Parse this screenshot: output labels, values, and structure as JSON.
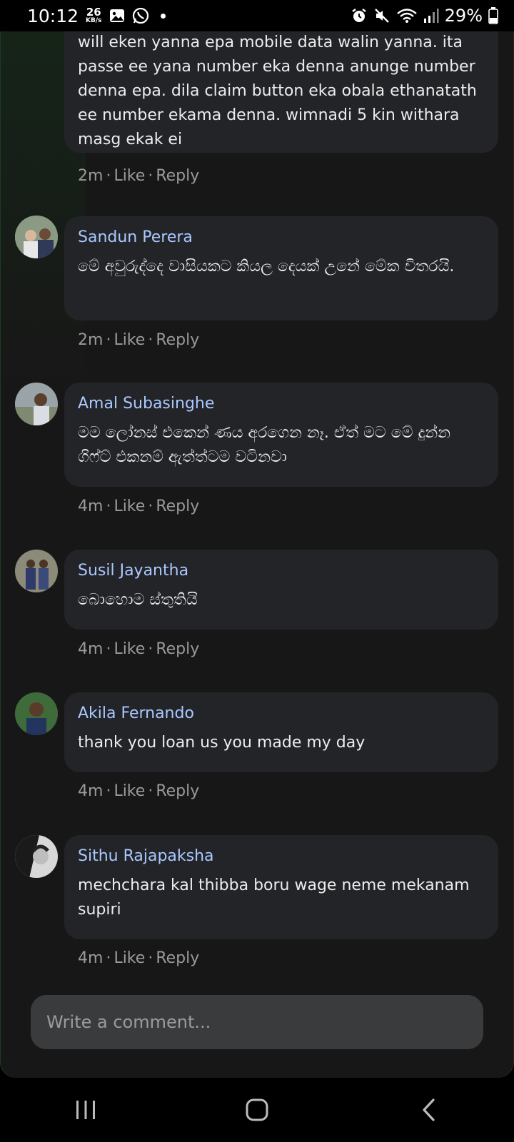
{
  "status_bar": {
    "time": "10:12",
    "net_speed_value": "26",
    "net_speed_unit": "KB/s",
    "battery_percent": "29%",
    "icons": [
      "gallery-icon",
      "whatsapp-icon",
      "dot",
      "alarm-icon",
      "mute-icon",
      "wifi-icon",
      "signal-icon",
      "battery-icon"
    ]
  },
  "partial_comment": {
    "text": "will eken yanna epa mobile data walin yanna. ita passe ee yana number eka denna anunge number denna epa. dila claim button eka obala ethanatath ee number ekama denna. wimnadi 5 kin withara masg ekak ei",
    "time": "2m",
    "like_label": "Like",
    "reply_label": "Reply"
  },
  "comments": [
    {
      "author": "Sandun Perera",
      "text": "මේ අවුරුද්දෙ වාසියකට කියල දෙයක් උනේ මේක විතරයි.",
      "time": "2m",
      "like_label": "Like",
      "reply_label": "Reply"
    },
    {
      "author": "Amal Subasinghe",
      "text": "මම ලෝනස් එකෙන් ණය අරගෙන නෑ. ඒත් මට මේ දුන්න ගිෆ්ට් එකනම් ඇත්ත්ටම වටිනවා",
      "time": "4m",
      "like_label": "Like",
      "reply_label": "Reply"
    },
    {
      "author": "Susil Jayantha",
      "text": "බොහොම ස්තුතියි",
      "time": "4m",
      "like_label": "Like",
      "reply_label": "Reply"
    },
    {
      "author": "Akila Fernando",
      "text": "thank you loan us you made my day",
      "time": "4m",
      "like_label": "Like",
      "reply_label": "Reply"
    },
    {
      "author": "Sithu Rajapaksha",
      "text": "mechchara kal thibba boru wage neme mekanam supiri",
      "time": "4m",
      "like_label": "Like",
      "reply_label": "Reply"
    }
  ],
  "comment_input": {
    "placeholder": "Write a comment..."
  },
  "nav_bar": {
    "icons": [
      "recents-icon",
      "home-icon",
      "back-icon"
    ]
  },
  "colors": {
    "background": "#171717",
    "bubble": "#232428",
    "author": "#a9c8ff",
    "meta": "#9a9a9a",
    "input": "#3a3b3d"
  }
}
